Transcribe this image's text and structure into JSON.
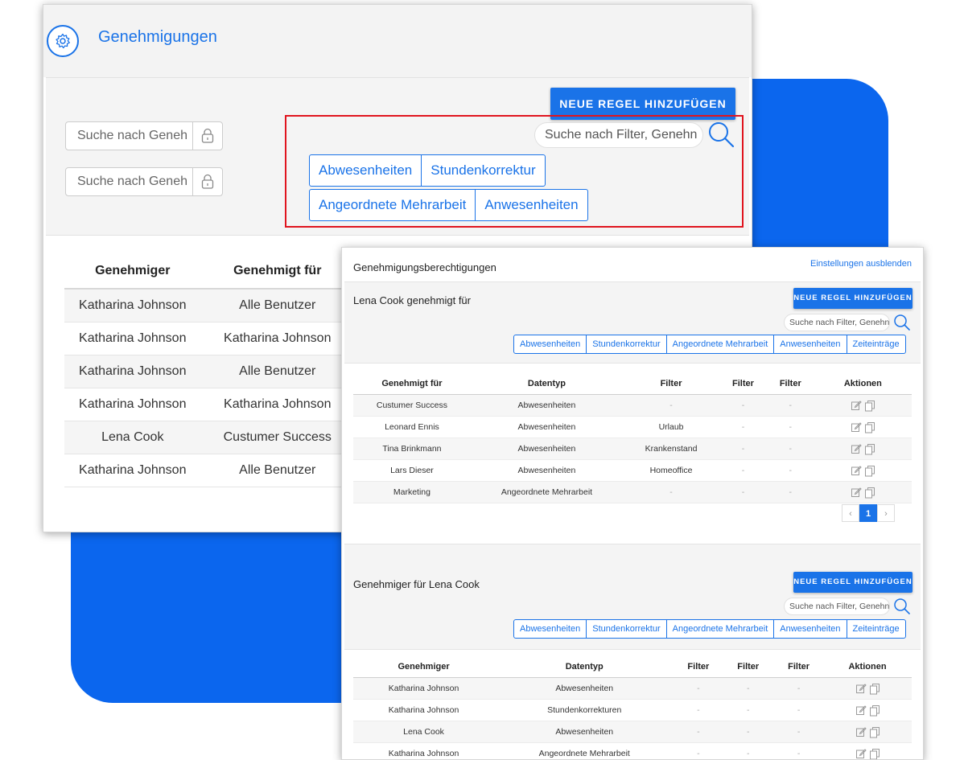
{
  "colors": {
    "accent": "#1a73e8",
    "backdrop": "#0b66ee",
    "highlight": "#e0141e"
  },
  "back": {
    "title": "Genehmigungen",
    "icon": "gear-icon",
    "add_rule_label": "NEUE REGEL HINZUFÜGEN",
    "approver_search_placeholder": "Suche nach Geneh",
    "approved_search_placeholder": "Suche nach Geneh",
    "filter_search_placeholder": "Suche nach Filter, Genehn",
    "filter_row1": [
      "Abwesenheiten",
      "Stundenkorrektur"
    ],
    "filter_row2": [
      "Angeordnete Mehrarbeit",
      "Anwesenheiten"
    ],
    "table": {
      "headers": [
        "Genehmiger",
        "Genehmigt für"
      ],
      "rows": [
        [
          "Katharina Johnson",
          "Alle Benutzer"
        ],
        [
          "Katharina Johnson",
          "Katharina Johnson"
        ],
        [
          "Katharina Johnson",
          "Alle Benutzer"
        ],
        [
          "Katharina Johnson",
          "Katharina Johnson"
        ],
        [
          "Lena Cook",
          "Custumer Success"
        ],
        [
          "Katharina Johnson",
          "Alle Benutzer"
        ]
      ]
    }
  },
  "front": {
    "title": "Genehmigungsberechtigungen",
    "hide_settings_label": "Einstellungen ausblenden",
    "section1": {
      "title": "Lena Cook genehmigt für",
      "add_rule_label": "NEUE REGEL HINZUFÜGEN",
      "search_placeholder": "Suche nach Filter, Genehn",
      "filters": [
        "Abwesenheiten",
        "Stundenkorrektur",
        "Angeordnete Mehrarbeit",
        "Anwesenheiten",
        "Zeiteinträge"
      ],
      "table": {
        "headers": [
          "Genehmigt für",
          "Datentyp",
          "Filter",
          "Filter",
          "Filter",
          "Aktionen"
        ],
        "rows": [
          [
            "Custumer Success",
            "Abwesenheiten",
            "-",
            "-",
            "-"
          ],
          [
            "Leonard Ennis",
            "Abwesenheiten",
            "Urlaub",
            "-",
            "-"
          ],
          [
            "Tina Brinkmann",
            "Abwesenheiten",
            "Krankenstand",
            "-",
            "-"
          ],
          [
            "Lars Dieser",
            "Abwesenheiten",
            "Homeoffice",
            "-",
            "-"
          ],
          [
            "Marketing",
            "Angeordnete Mehrarbeit",
            "-",
            "-",
            "-"
          ]
        ]
      },
      "pager": {
        "prev": "‹",
        "current": "1",
        "next": "›"
      }
    },
    "section2": {
      "title": "Genehmiger für Lena Cook",
      "add_rule_label": "NEUE REGEL HINZUFÜGEN",
      "search_placeholder": "Suche nach Filter, Genehn",
      "filters": [
        "Abwesenheiten",
        "Stundenkorrektur",
        "Angeordnete Mehrarbeit",
        "Anwesenheiten",
        "Zeiteinträge"
      ],
      "table": {
        "headers": [
          "Genehmiger",
          "Datentyp",
          "Filter",
          "Filter",
          "Filter",
          "Aktionen"
        ],
        "rows": [
          [
            "Katharina Johnson",
            "Abwesenheiten",
            "-",
            "-",
            "-"
          ],
          [
            "Katharina Johnson",
            "Stundenkorrekturen",
            "-",
            "-",
            "-"
          ],
          [
            "Lena Cook",
            "Abwesenheiten",
            "-",
            "-",
            "-"
          ],
          [
            "Katharina Johnson",
            "Angeordnete Mehrarbeit",
            "-",
            "-",
            "-"
          ]
        ]
      }
    }
  }
}
